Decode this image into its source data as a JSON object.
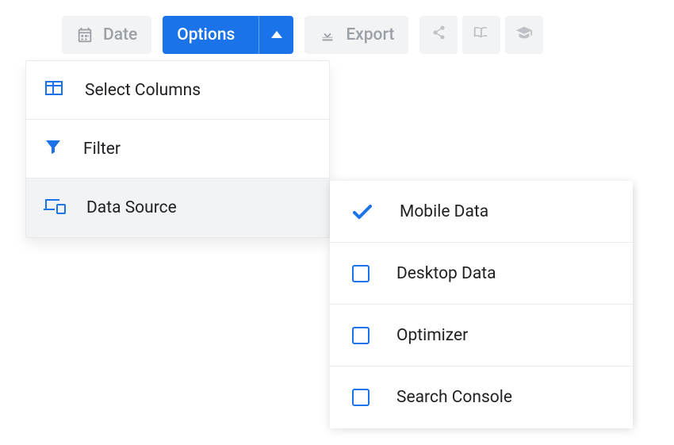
{
  "toolbar": {
    "date_label": "Date",
    "options_label": "Options",
    "export_label": "Export"
  },
  "options_menu": {
    "items": [
      {
        "label": "Select Columns"
      },
      {
        "label": "Filter"
      },
      {
        "label": "Data Source"
      }
    ]
  },
  "data_source_menu": {
    "items": [
      {
        "label": "Mobile Data",
        "checked": true
      },
      {
        "label": "Desktop Data",
        "checked": false
      },
      {
        "label": "Optimizer",
        "checked": false
      },
      {
        "label": "Search Console",
        "checked": false
      }
    ]
  }
}
